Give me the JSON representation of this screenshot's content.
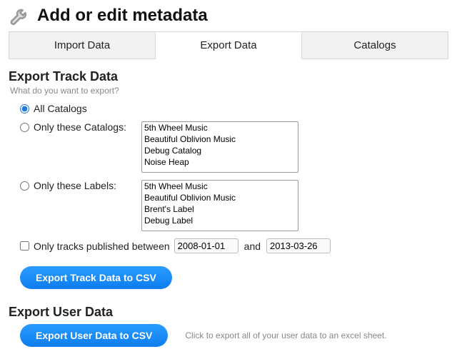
{
  "header": {
    "title": "Add or edit metadata"
  },
  "tabs": {
    "import": "Import Data",
    "export": "Export Data",
    "catalogs": "Catalogs"
  },
  "exportTrack": {
    "title": "Export Track Data",
    "hint": "What do you want to export?",
    "allCatalogs": "All Catalogs",
    "onlyCatalogs": "Only these Catalogs:",
    "onlyLabels": "Only these Labels:",
    "catalogOptions": [
      "5th Wheel Music",
      "Beautiful Oblivion Music",
      "Debug Catalog",
      "Noise Heap"
    ],
    "labelOptions": [
      "5th Wheel Music",
      "Beautiful Oblivion Music",
      "Brent's Label",
      "Debug Label"
    ],
    "onlyBetween": "Only tracks published between",
    "and": "and",
    "dateStart": "2008-01-01",
    "dateEnd": "2013-03-26",
    "button": "Export Track Data to CSV"
  },
  "exportUser": {
    "title": "Export User Data",
    "button": "Export User Data to CSV",
    "hint": "Click to export all of your user data to an excel sheet."
  }
}
